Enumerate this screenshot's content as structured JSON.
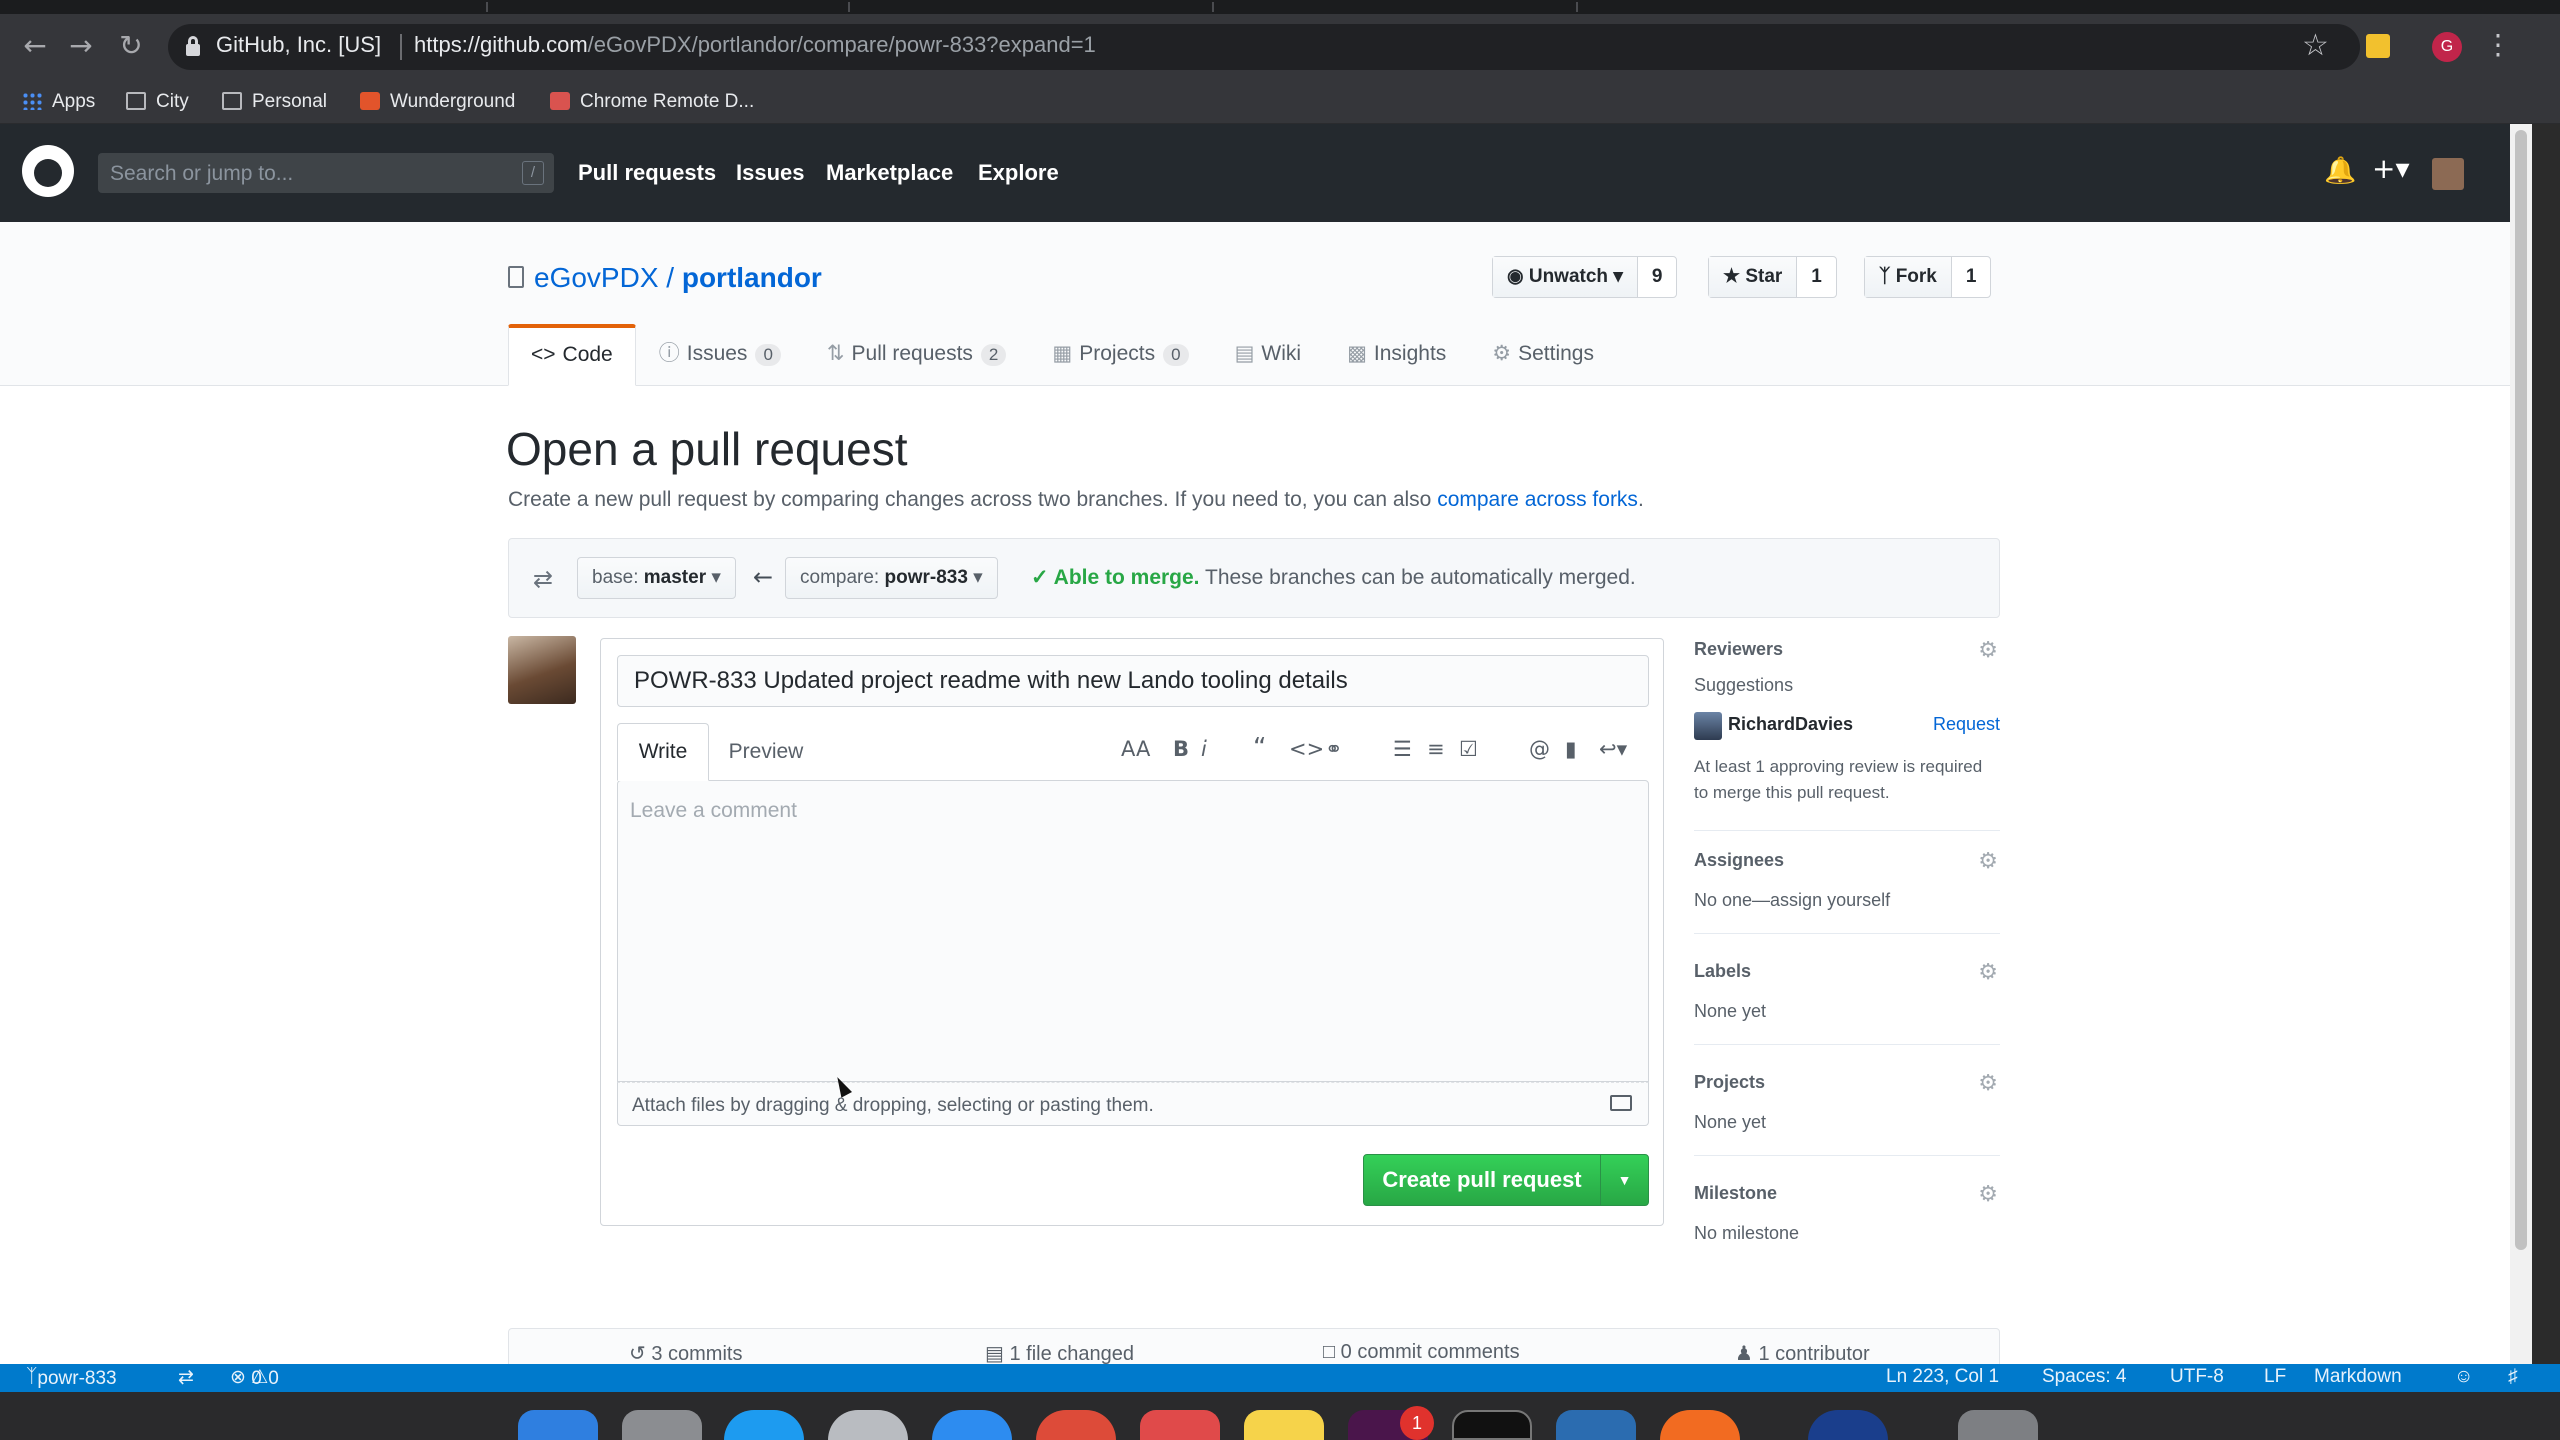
{
  "browser": {
    "org": "GitHub, Inc. [US]",
    "url_host": "https://github.com",
    "url_path": "/eGovPDX/portlandor/compare/powr-833?expand=1",
    "profile_initial": "G",
    "bookmarks": [
      "Apps",
      "City",
      "Personal",
      "Wunderground",
      "Chrome Remote D..."
    ]
  },
  "header": {
    "search_placeholder": "Search or jump to...",
    "search_shortcut": "/",
    "nav": [
      "Pull requests",
      "Issues",
      "Marketplace",
      "Explore"
    ]
  },
  "repo": {
    "owner": "eGovPDX",
    "separator": " / ",
    "name": "portlandor",
    "unwatch_label": "Unwatch",
    "watch_count": "9",
    "star_label": "Star",
    "star_count": "1",
    "fork_label": "Fork",
    "fork_count": "1"
  },
  "tabs": [
    {
      "label": "Code",
      "icon": "code-icon"
    },
    {
      "label": "Issues",
      "count": "0",
      "icon": "issue-icon"
    },
    {
      "label": "Pull requests",
      "count": "2",
      "icon": "pull-request-icon"
    },
    {
      "label": "Projects",
      "count": "0",
      "icon": "project-icon"
    },
    {
      "label": "Wiki",
      "icon": "book-icon"
    },
    {
      "label": "Insights",
      "icon": "graph-icon"
    },
    {
      "label": "Settings",
      "icon": "gear-icon"
    }
  ],
  "page": {
    "title": "Open a pull request",
    "subtitle": "Create a new pull request by comparing changes across two branches. If you need to, you can also ",
    "subtitle_link": "compare across forks",
    "subtitle_end": "."
  },
  "compare": {
    "base_prefix": "base: ",
    "base": "master",
    "compare_prefix": "compare: ",
    "compare": "powr-833",
    "status_ok": "Able to merge.",
    "status_text": " These branches can be automatically merged."
  },
  "composer": {
    "title_value": "POWR-833 Updated project readme with new Lando tooling details",
    "write_tab": "Write",
    "preview_tab": "Preview",
    "comment_placeholder": "Leave a comment",
    "attach_text": "Attach files by dragging & dropping, selecting or pasting them.",
    "submit_label": "Create pull request"
  },
  "sidebar": {
    "reviewers": {
      "heading": "Reviewers",
      "suggestions_label": "Suggestions",
      "suggested_user": "RichardDavies",
      "request_label": "Request",
      "note": "At least 1 approving review is required to merge this pull request."
    },
    "assignees": {
      "heading": "Assignees",
      "text": "No one—assign yourself"
    },
    "labels": {
      "heading": "Labels",
      "text": "None yet"
    },
    "projects": {
      "heading": "Projects",
      "text": "None yet"
    },
    "milestone": {
      "heading": "Milestone",
      "text": "No milestone"
    }
  },
  "summary": {
    "commits": "3 commits",
    "files": "1 file changed",
    "comments": "0 commit comments",
    "contributors": "1 contributor"
  },
  "statusbar": {
    "branch": "powr-833",
    "problems": "0",
    "warnings": "0",
    "position": "Ln 223, Col 1",
    "spaces": "Spaces: 4",
    "encoding": "UTF-8",
    "eol": "LF",
    "language": "Markdown"
  },
  "dock": {
    "badge_count": "1"
  },
  "colors": {
    "github_header": "#24292e",
    "link": "#0366d6",
    "success": "#28a745",
    "tab_accent": "#e36209",
    "statusbar": "#007acc"
  }
}
